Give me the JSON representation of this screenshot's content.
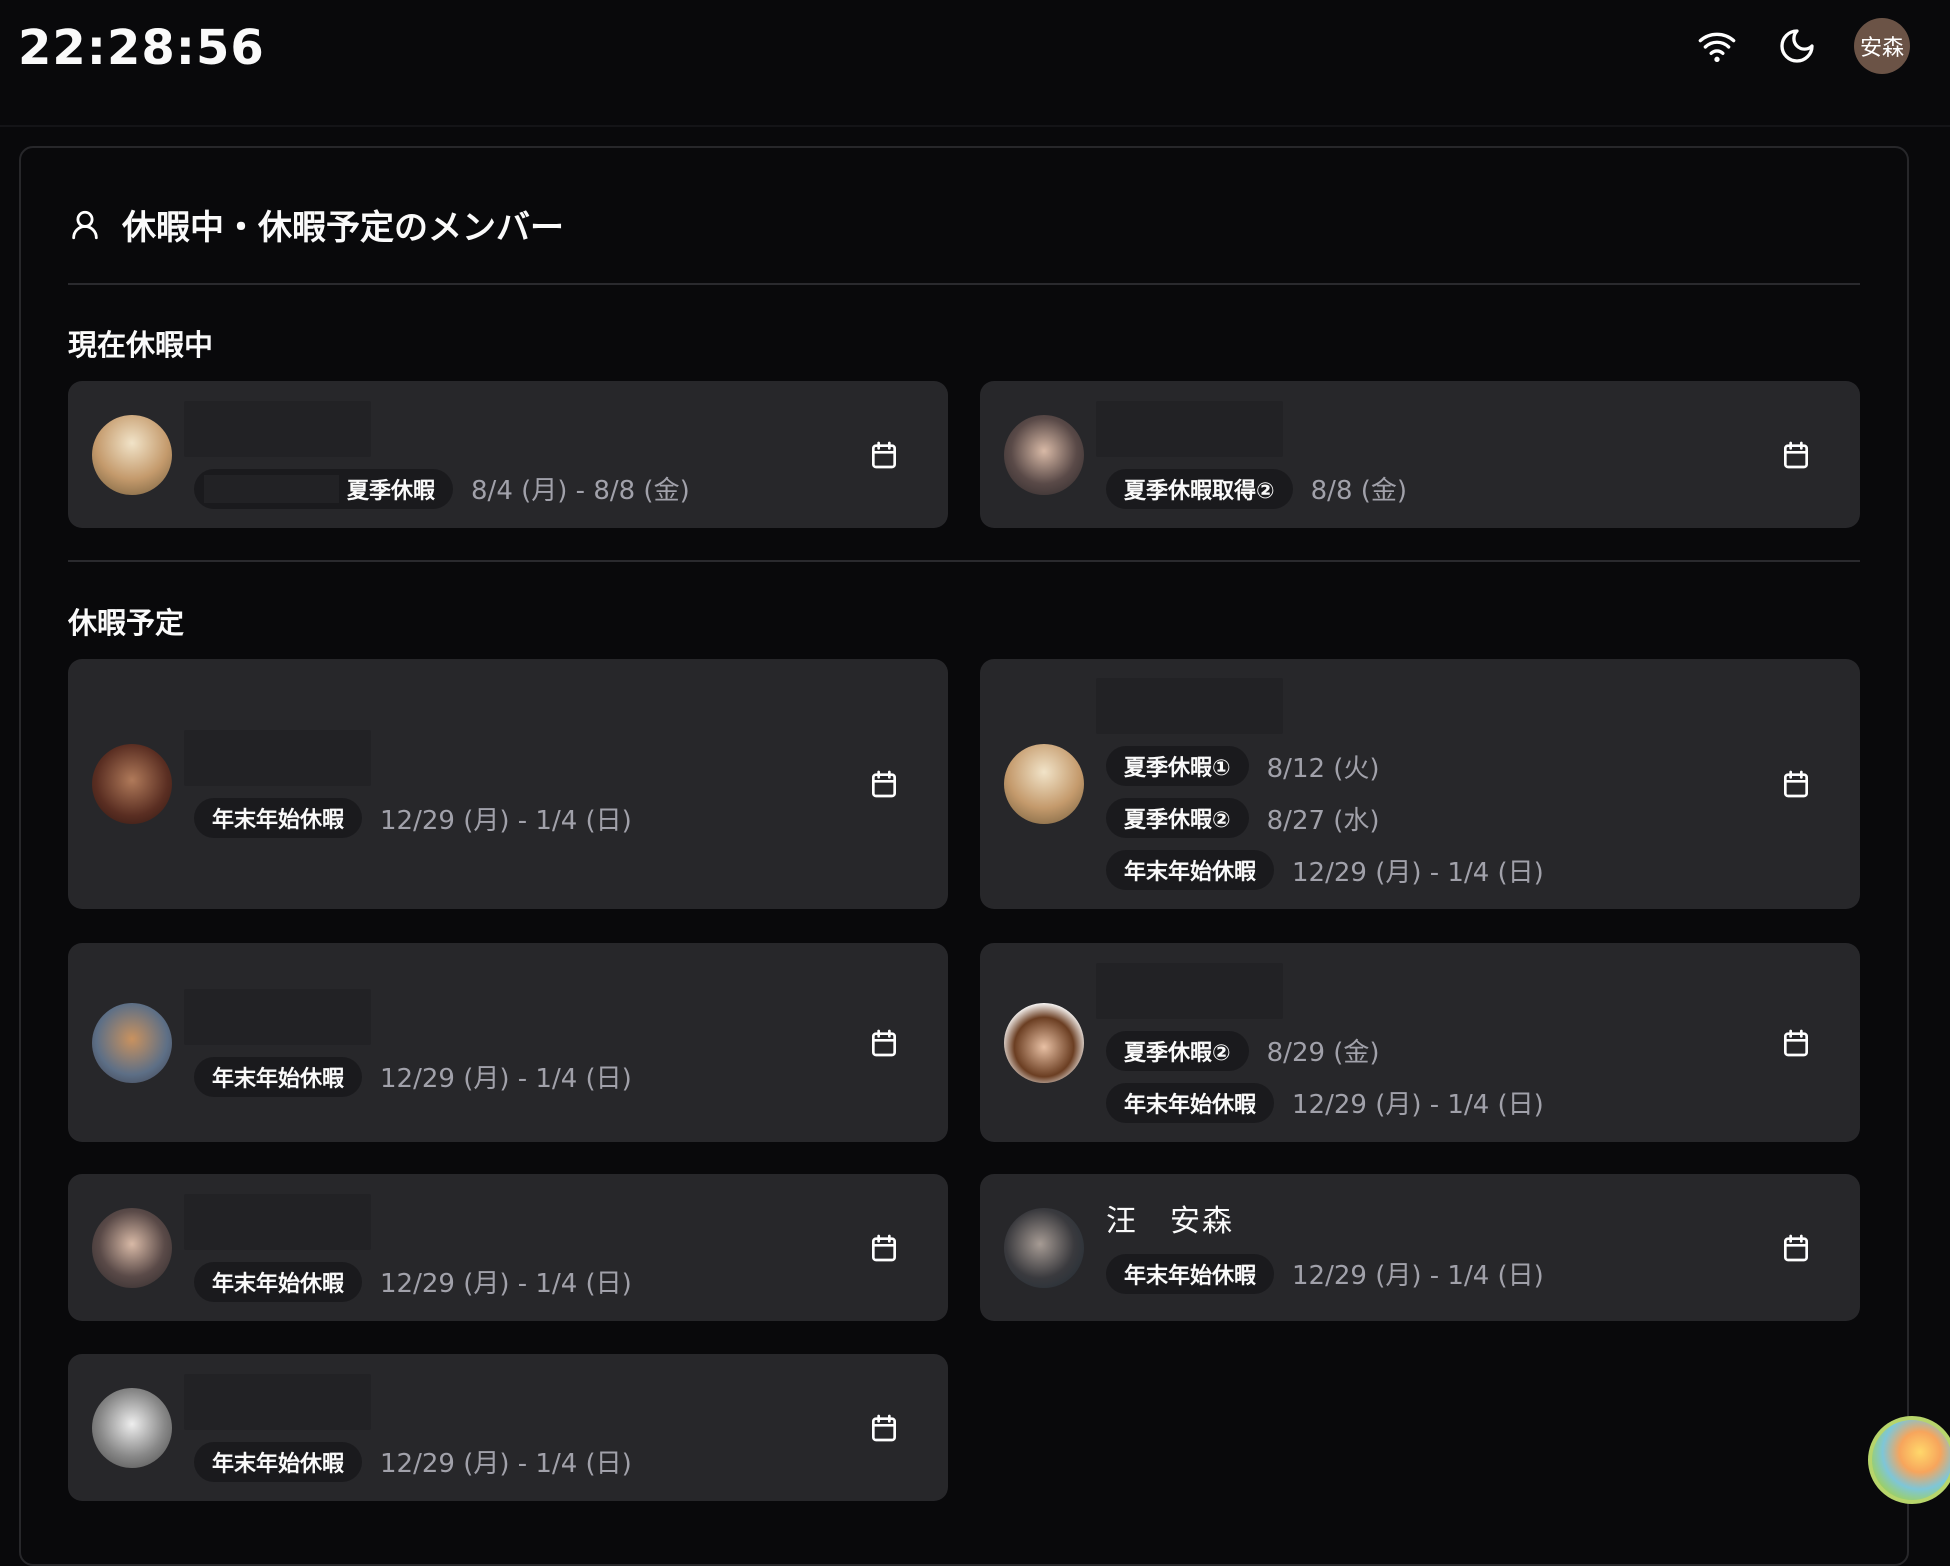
{
  "header": {
    "clock": "22:28:56",
    "user_initials": "安森",
    "icons": [
      "wifi-icon",
      "moon-icon"
    ]
  },
  "panel": {
    "title": "休暇中・休暇予定のメンバー",
    "current_label": "現在休暇中",
    "upcoming_label": "休暇予定"
  },
  "current": [
    {
      "name": null,
      "leaves": [
        {
          "label": "夏季休暇",
          "date": "8/4 (月) - 8/8 (金)",
          "redacted_prefix": true
        }
      ]
    },
    {
      "name": null,
      "leaves": [
        {
          "label": "夏季休暇取得②",
          "date": "8/8 (金)"
        }
      ]
    }
  ],
  "upcoming": [
    {
      "name": null,
      "leaves": [
        {
          "label": "年末年始休暇",
          "date": "12/29 (月) - 1/4 (日)"
        }
      ]
    },
    {
      "name": null,
      "leaves": [
        {
          "label": "夏季休暇①",
          "date": "8/12 (火)"
        },
        {
          "label": "夏季休暇②",
          "date": "8/27 (水)"
        },
        {
          "label": "年末年始休暇",
          "date": "12/29 (月) - 1/4 (日)"
        }
      ]
    },
    {
      "name": null,
      "leaves": [
        {
          "label": "年末年始休暇",
          "date": "12/29 (月) - 1/4 (日)"
        }
      ]
    },
    {
      "name": null,
      "leaves": [
        {
          "label": "夏季休暇②",
          "date": "8/29 (金)"
        },
        {
          "label": "年末年始休暇",
          "date": "12/29 (月) - 1/4 (日)"
        }
      ]
    },
    {
      "name": null,
      "leaves": [
        {
          "label": "年末年始休暇",
          "date": "12/29 (月) - 1/4 (日)"
        }
      ]
    },
    {
      "name": "汪　安森",
      "leaves": [
        {
          "label": "年末年始休暇",
          "date": "12/29 (月) - 1/4 (日)"
        }
      ]
    },
    {
      "name": null,
      "leaves": [
        {
          "label": "年末年始休暇",
          "date": "12/29 (月) - 1/4 (日)"
        }
      ]
    }
  ],
  "colors": {
    "background": "#09090b",
    "card": "#27272a",
    "badge": "#1a1a1d",
    "date_text": "#a1a1aa"
  }
}
